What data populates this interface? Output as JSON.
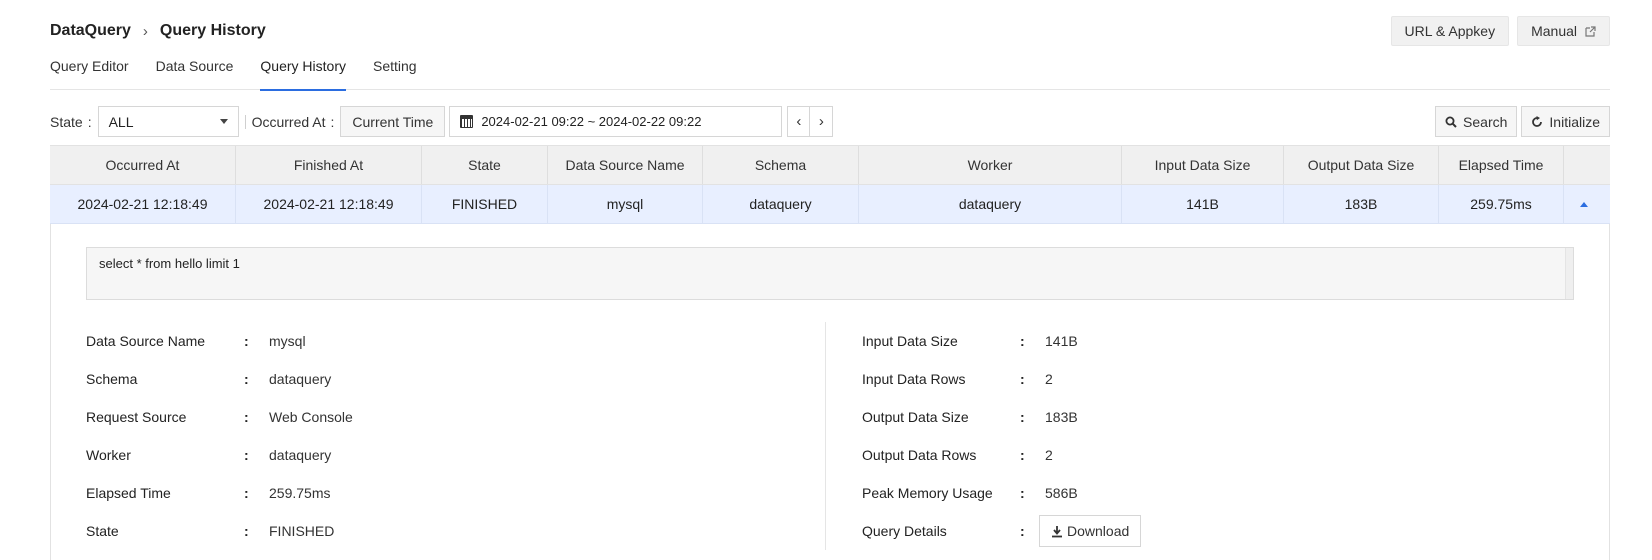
{
  "breadcrumb": {
    "root": "DataQuery",
    "current": "Query History"
  },
  "top_buttons": {
    "url_appkey": "URL & Appkey",
    "manual": "Manual"
  },
  "tabs": [
    {
      "label": "Query Editor",
      "active": false
    },
    {
      "label": "Data Source",
      "active": false
    },
    {
      "label": "Query History",
      "active": true
    },
    {
      "label": "Setting",
      "active": false
    }
  ],
  "filters": {
    "state_label": "State",
    "state_value": "ALL",
    "occurred_label": "Occurred At",
    "current_time": "Current Time",
    "date_range": "2024-02-21 09:22 ~ 2024-02-22 09:22",
    "search": "Search",
    "initialize": "Initialize"
  },
  "table": {
    "columns": [
      "Occurred At",
      "Finished At",
      "State",
      "Data Source Name",
      "Schema",
      "Worker",
      "Input Data Size",
      "Output Data Size",
      "Elapsed Time"
    ],
    "rows": [
      [
        "2024-02-21 12:18:49",
        "2024-02-21 12:18:49",
        "FINISHED",
        "mysql",
        "dataquery",
        "dataquery",
        "141B",
        "183B",
        "259.75ms"
      ]
    ]
  },
  "detail": {
    "sql": "select * from hello limit 1",
    "left": [
      {
        "key": "Data Source Name",
        "value": "mysql"
      },
      {
        "key": "Schema",
        "value": "dataquery"
      },
      {
        "key": "Request Source",
        "value": "Web Console"
      },
      {
        "key": "Worker",
        "value": "dataquery"
      },
      {
        "key": "Elapsed Time",
        "value": "259.75ms"
      },
      {
        "key": "State",
        "value": "FINISHED"
      }
    ],
    "right": [
      {
        "key": "Input Data Size",
        "value": "141B"
      },
      {
        "key": "Input Data Rows",
        "value": "2"
      },
      {
        "key": "Output Data Size",
        "value": "183B"
      },
      {
        "key": "Output Data Rows",
        "value": "2"
      },
      {
        "key": "Peak Memory Usage",
        "value": "586B"
      },
      {
        "key": "Query Details",
        "value": ""
      }
    ],
    "download_label": "Download",
    "colon": ":"
  },
  "icons": {
    "external_link": "external-link-icon",
    "calendar": "calendar-icon",
    "search": "search-icon",
    "refresh": "refresh-icon",
    "download": "download-icon",
    "accent": "#2b6de0"
  }
}
